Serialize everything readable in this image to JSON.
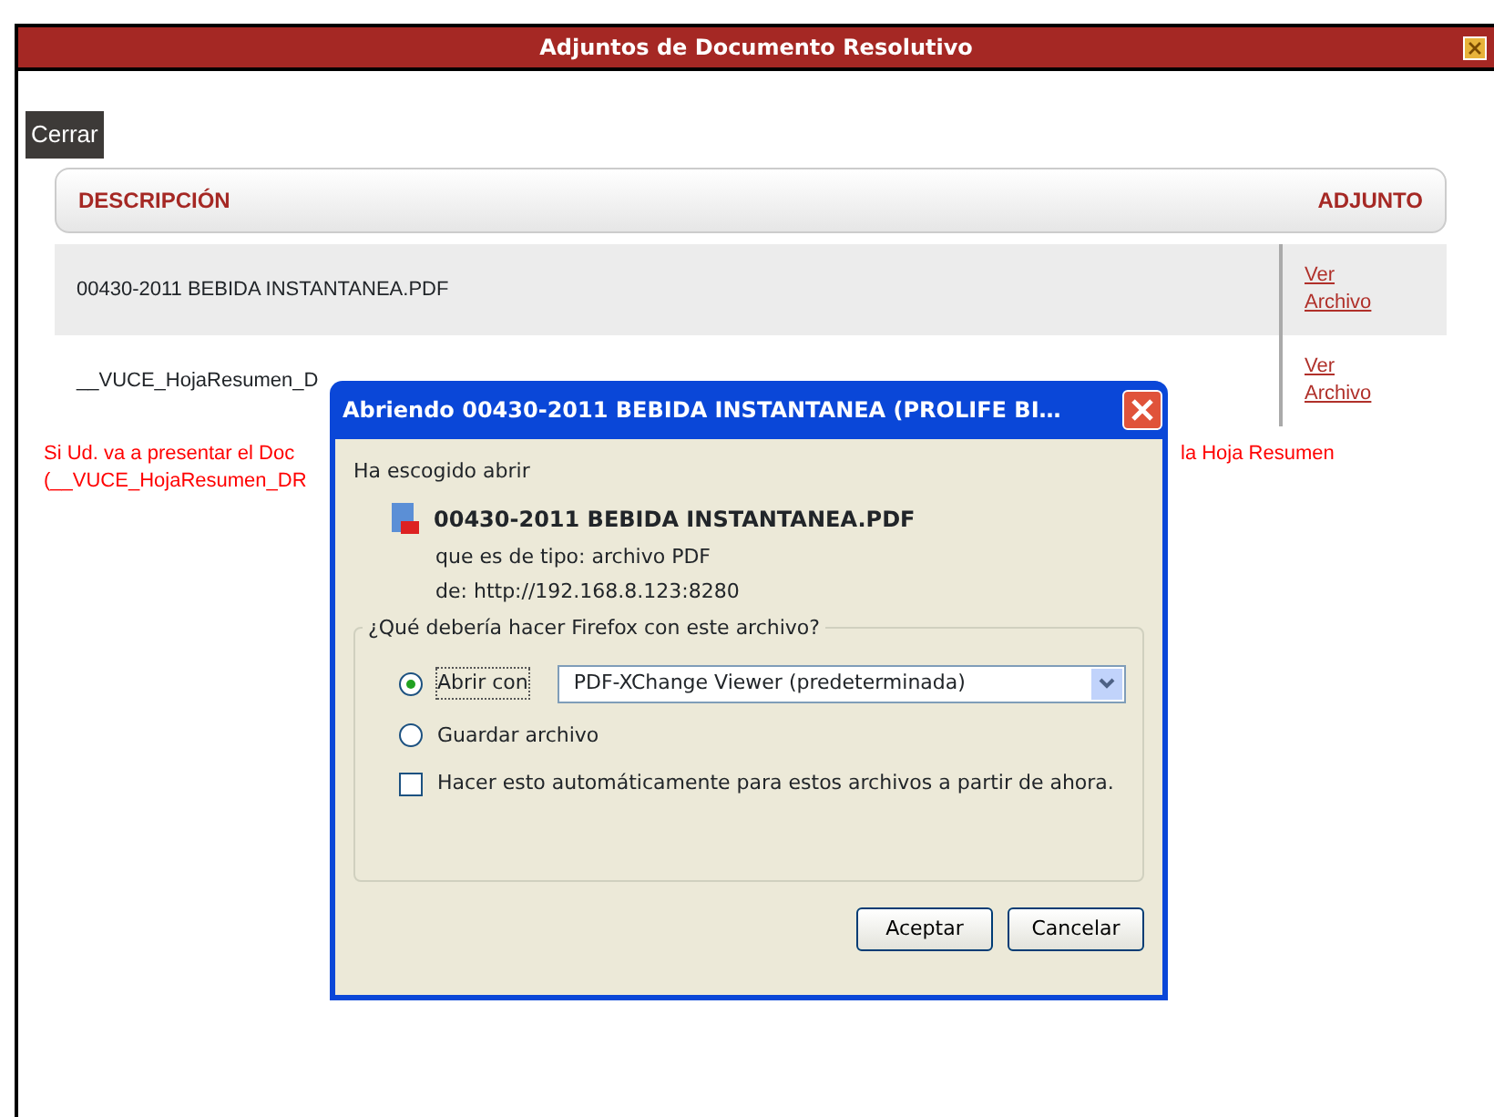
{
  "window": {
    "title": "Adjuntos de Documento Resolutivo"
  },
  "close_button": "Cerrar",
  "table": {
    "columns": [
      "DESCRIPCIÓN",
      "ADJUNTO"
    ],
    "rows": [
      {
        "description": "00430-2011 BEBIDA INSTANTANEA.PDF",
        "link": "Ver Archivo"
      },
      {
        "description": "__VUCE_HojaResumen_D",
        "link": "Ver Archivo"
      }
    ]
  },
  "notice": {
    "line_1_start": "Si Ud. va a presentar el Doc",
    "line_1_end": "la Hoja Resumen",
    "line_2_start": "(__VUCE_HojaResumen_DR"
  },
  "dialog": {
    "title": "Abriendo 00430-2011 BEBIDA INSTANTANEA (PROLIFE BI…",
    "intro": "Ha escogido abrir",
    "file_name": "00430-2011 BEBIDA INSTANTANEA.PDF",
    "type_label": "que es de tipo:",
    "type_value": "archivo PDF",
    "from_label": "de:",
    "from_value": "http://192.168.8.123:8280",
    "group_label": "¿Qué debería hacer Firefox con este archivo?",
    "options": [
      {
        "kind": "radio",
        "label": "Abrir con",
        "selected": true,
        "app": "PDF-XChange Viewer (predeterminada)"
      },
      {
        "kind": "radio",
        "label": "Guardar archivo",
        "selected": false
      },
      {
        "kind": "checkbox",
        "label": "Hacer esto automáticamente para estos archivos a partir de ahora.",
        "checked": false
      }
    ],
    "buttons": [
      "Aceptar",
      "Cancelar"
    ]
  }
}
